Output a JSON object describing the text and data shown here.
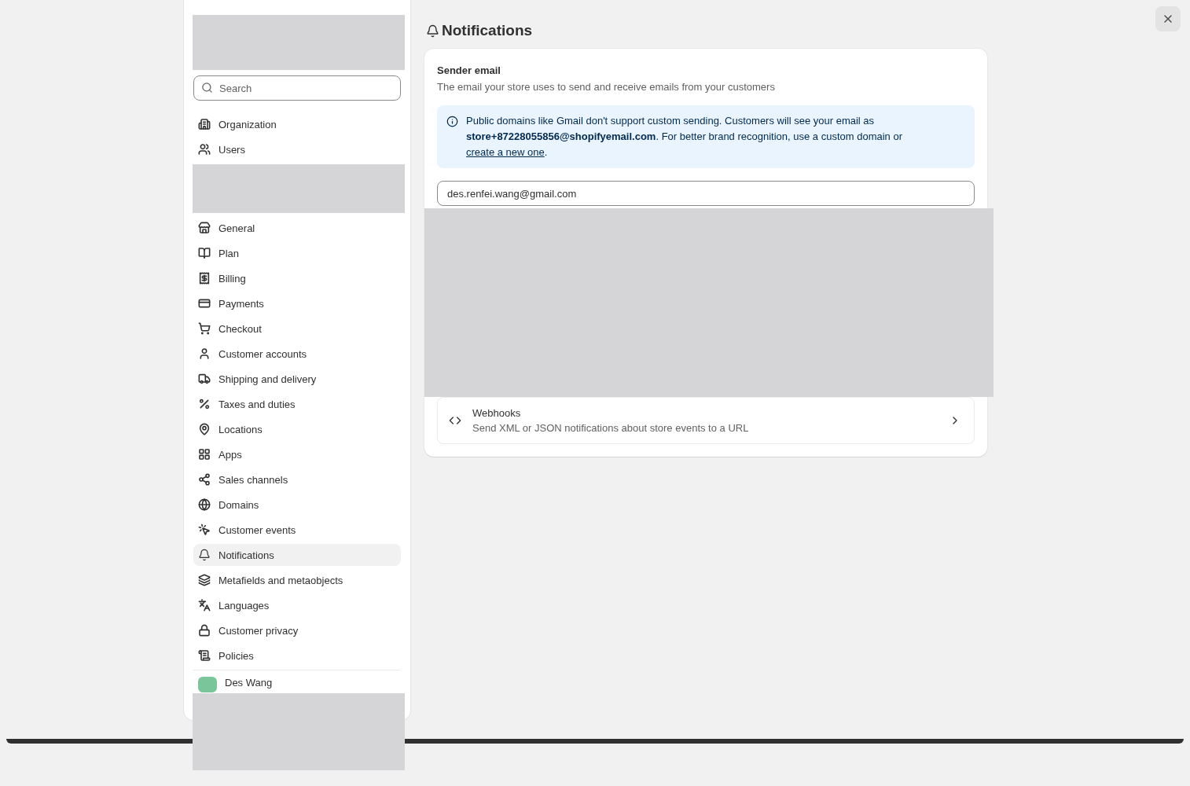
{
  "sidebar": {
    "search": {
      "placeholder": "Search"
    },
    "account_items": [
      {
        "label": "Organization",
        "selected": false
      },
      {
        "label": "Users",
        "selected": false
      }
    ],
    "store_items": [
      {
        "label": "General",
        "selected": false
      },
      {
        "label": "Plan",
        "selected": false
      },
      {
        "label": "Billing",
        "selected": false
      },
      {
        "label": "Payments",
        "selected": false
      },
      {
        "label": "Checkout",
        "selected": false
      },
      {
        "label": "Customer accounts",
        "selected": false
      },
      {
        "label": "Shipping and delivery",
        "selected": false
      },
      {
        "label": "Taxes and duties",
        "selected": false
      },
      {
        "label": "Locations",
        "selected": false
      },
      {
        "label": "Apps",
        "selected": false
      },
      {
        "label": "Sales channels",
        "selected": false
      },
      {
        "label": "Domains",
        "selected": false
      },
      {
        "label": "Customer events",
        "selected": false
      },
      {
        "label": "Notifications",
        "selected": true
      },
      {
        "label": "Metafields and metaobjects",
        "selected": false
      },
      {
        "label": "Languages",
        "selected": false
      },
      {
        "label": "Customer privacy",
        "selected": false
      },
      {
        "label": "Policies",
        "selected": false
      }
    ],
    "user": {
      "name": "Des Wang"
    }
  },
  "page": {
    "title": "Notifications",
    "sender_email": {
      "heading": "Sender email",
      "description": "The email your store uses to send and receive emails from your customers",
      "banner": {
        "text": "Public domains like Gmail don't support custom sending. Customers will see your email as **store+87228055856@shopifyemail.com**. For better brand recognition, use a custom domain or",
        "link": "create a new one",
        "after": "."
      },
      "email": "des.renfei.wang@gmail.com"
    },
    "webhooks": {
      "title": "Webhooks",
      "description": "Send XML or JSON notifications about store events to a URL"
    }
  }
}
